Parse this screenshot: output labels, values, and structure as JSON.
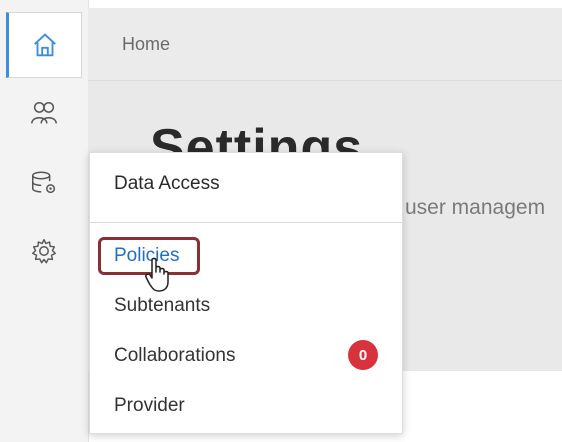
{
  "header": {
    "breadcrumb": "Home"
  },
  "page": {
    "title": "Settings",
    "subtitle": "user managem"
  },
  "rail": {
    "items": [
      {
        "icon": "home-icon",
        "active": true
      },
      {
        "icon": "users-icon",
        "active": false
      },
      {
        "icon": "database-gear-icon",
        "active": false
      },
      {
        "icon": "gear-icon",
        "active": false
      }
    ]
  },
  "flyout": {
    "title": "Data Access",
    "items": [
      {
        "label": "Policies",
        "selected": true
      },
      {
        "label": "Subtenants",
        "selected": false
      },
      {
        "label": "Collaborations",
        "selected": false,
        "badge": "0"
      },
      {
        "label": "Provider",
        "selected": false
      }
    ]
  },
  "colors": {
    "accent": "#1f6fc4",
    "rail_active": "#3b8edb",
    "badge": "#d8323d",
    "highlight_box": "#8a2f36"
  }
}
